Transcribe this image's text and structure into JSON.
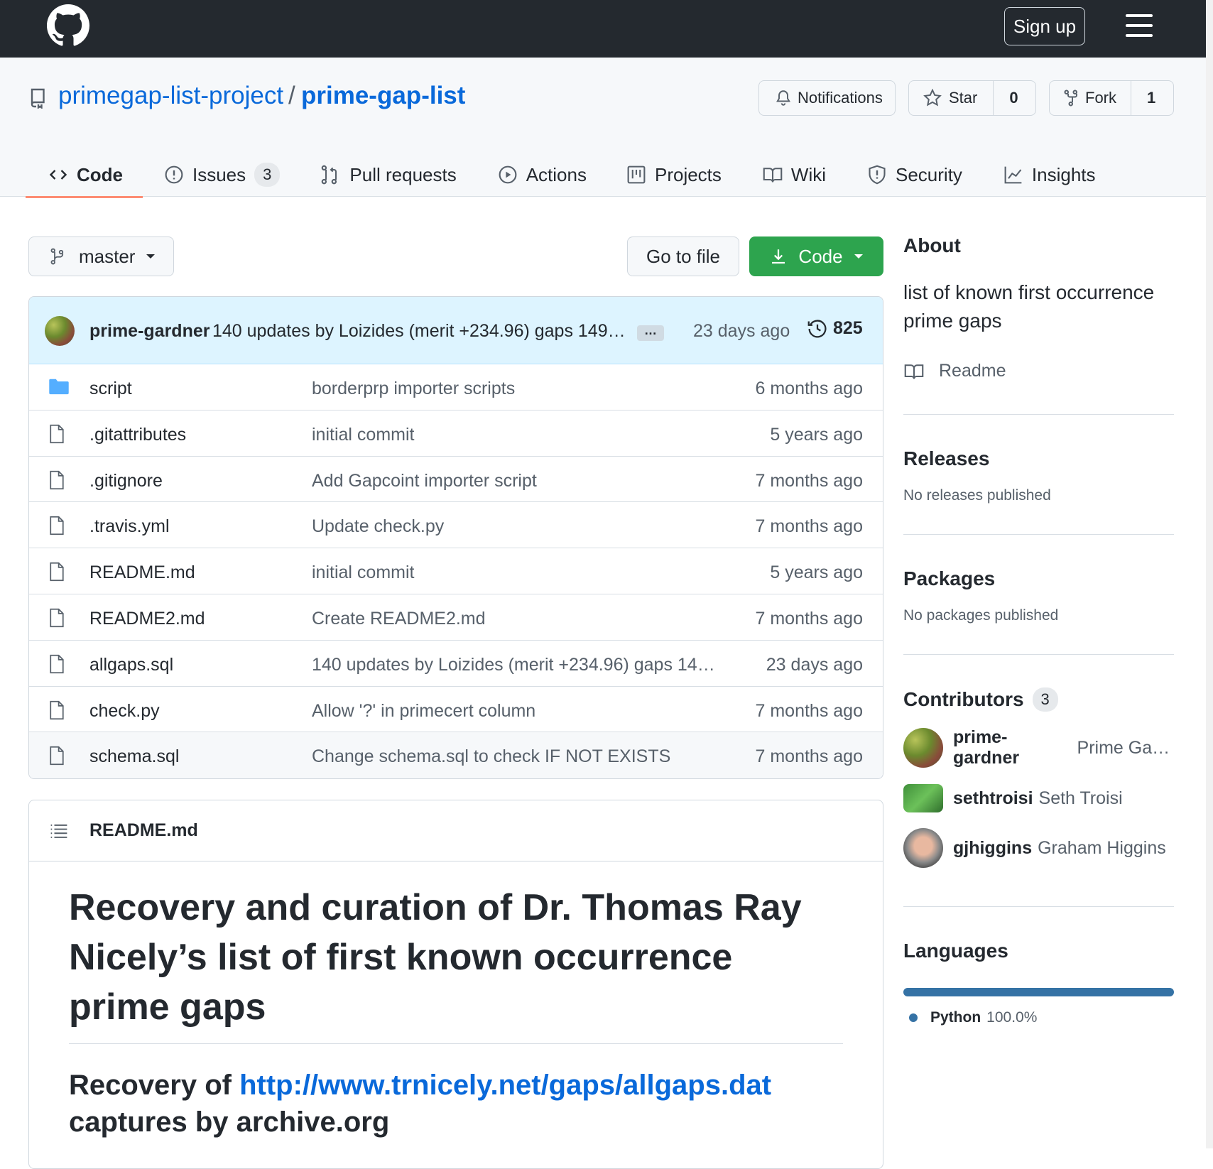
{
  "topbar": {
    "signup_label": "Sign up"
  },
  "repo": {
    "owner": "primegap-list-project",
    "separator": "/",
    "name": "prime-gap-list",
    "notifications_label": "Notifications",
    "star_label": "Star",
    "star_count": "0",
    "fork_label": "Fork",
    "fork_count": "1"
  },
  "tabs": [
    {
      "label": "Code",
      "icon": "code-icon"
    },
    {
      "label": "Issues",
      "icon": "issue-icon",
      "count": "3"
    },
    {
      "label": "Pull requests",
      "icon": "pull-request-icon"
    },
    {
      "label": "Actions",
      "icon": "play-icon"
    },
    {
      "label": "Projects",
      "icon": "project-icon"
    },
    {
      "label": "Wiki",
      "icon": "book-icon"
    },
    {
      "label": "Security",
      "icon": "shield-icon"
    },
    {
      "label": "Insights",
      "icon": "graph-icon"
    }
  ],
  "toolbar": {
    "branch": "master",
    "go_to_file": "Go to file",
    "code_label": "Code"
  },
  "latest_commit": {
    "author": "prime-gardner",
    "message": "140 updates by Loizides (merit +234.96) gaps 149…",
    "ellipsis": "…",
    "time": "23 days ago",
    "commit_count": "825"
  },
  "files": [
    {
      "type": "folder",
      "name": "script",
      "message": "borderprp importer scripts",
      "time": "6 months ago"
    },
    {
      "type": "file",
      "name": ".gitattributes",
      "message": "initial commit",
      "time": "5 years ago"
    },
    {
      "type": "file",
      "name": ".gitignore",
      "message": "Add Gapcoint importer script",
      "time": "7 months ago"
    },
    {
      "type": "file",
      "name": ".travis.yml",
      "message": "Update check.py",
      "time": "7 months ago"
    },
    {
      "type": "file",
      "name": "README.md",
      "message": "initial commit",
      "time": "5 years ago"
    },
    {
      "type": "file",
      "name": "README2.md",
      "message": "Create README2.md",
      "time": "7 months ago"
    },
    {
      "type": "file",
      "name": "allgaps.sql",
      "message": "140 updates by Loizides (merit +234.96) gaps 149…",
      "time": "23 days ago"
    },
    {
      "type": "file",
      "name": "check.py",
      "message": "Allow '?' in primecert column",
      "time": "7 months ago"
    },
    {
      "type": "file",
      "name": "schema.sql",
      "message": "Change schema.sql to check IF NOT EXISTS",
      "time": "7 months ago"
    }
  ],
  "readme": {
    "filename": "README.md",
    "h1": "Recovery and curation of Dr. Thomas Ray Nicely’s list of first known occurrence prime gaps",
    "h2_prefix": "Recovery of ",
    "h2_link": "http://www.trnicely.net/gaps/allgaps.dat",
    "h2_suffix": " captures by archive.org"
  },
  "sidebar": {
    "about_title": "About",
    "about_description": "list of known first occurrence prime gaps",
    "readme_label": "Readme",
    "releases_title": "Releases",
    "releases_empty": "No releases published",
    "packages_title": "Packages",
    "packages_empty": "No packages published",
    "contributors_title": "Contributors",
    "contributors_count": "3",
    "contributors": [
      {
        "login": "prime-gardner",
        "name": "Prime Gar…"
      },
      {
        "login": "sethtroisi",
        "name": "Seth Troisi"
      },
      {
        "login": "gjhiggins",
        "name": "Graham Higgins"
      }
    ],
    "languages_title": "Languages",
    "languages": [
      {
        "name": "Python",
        "percent": "100.0%",
        "color": "#3572a5"
      }
    ]
  }
}
